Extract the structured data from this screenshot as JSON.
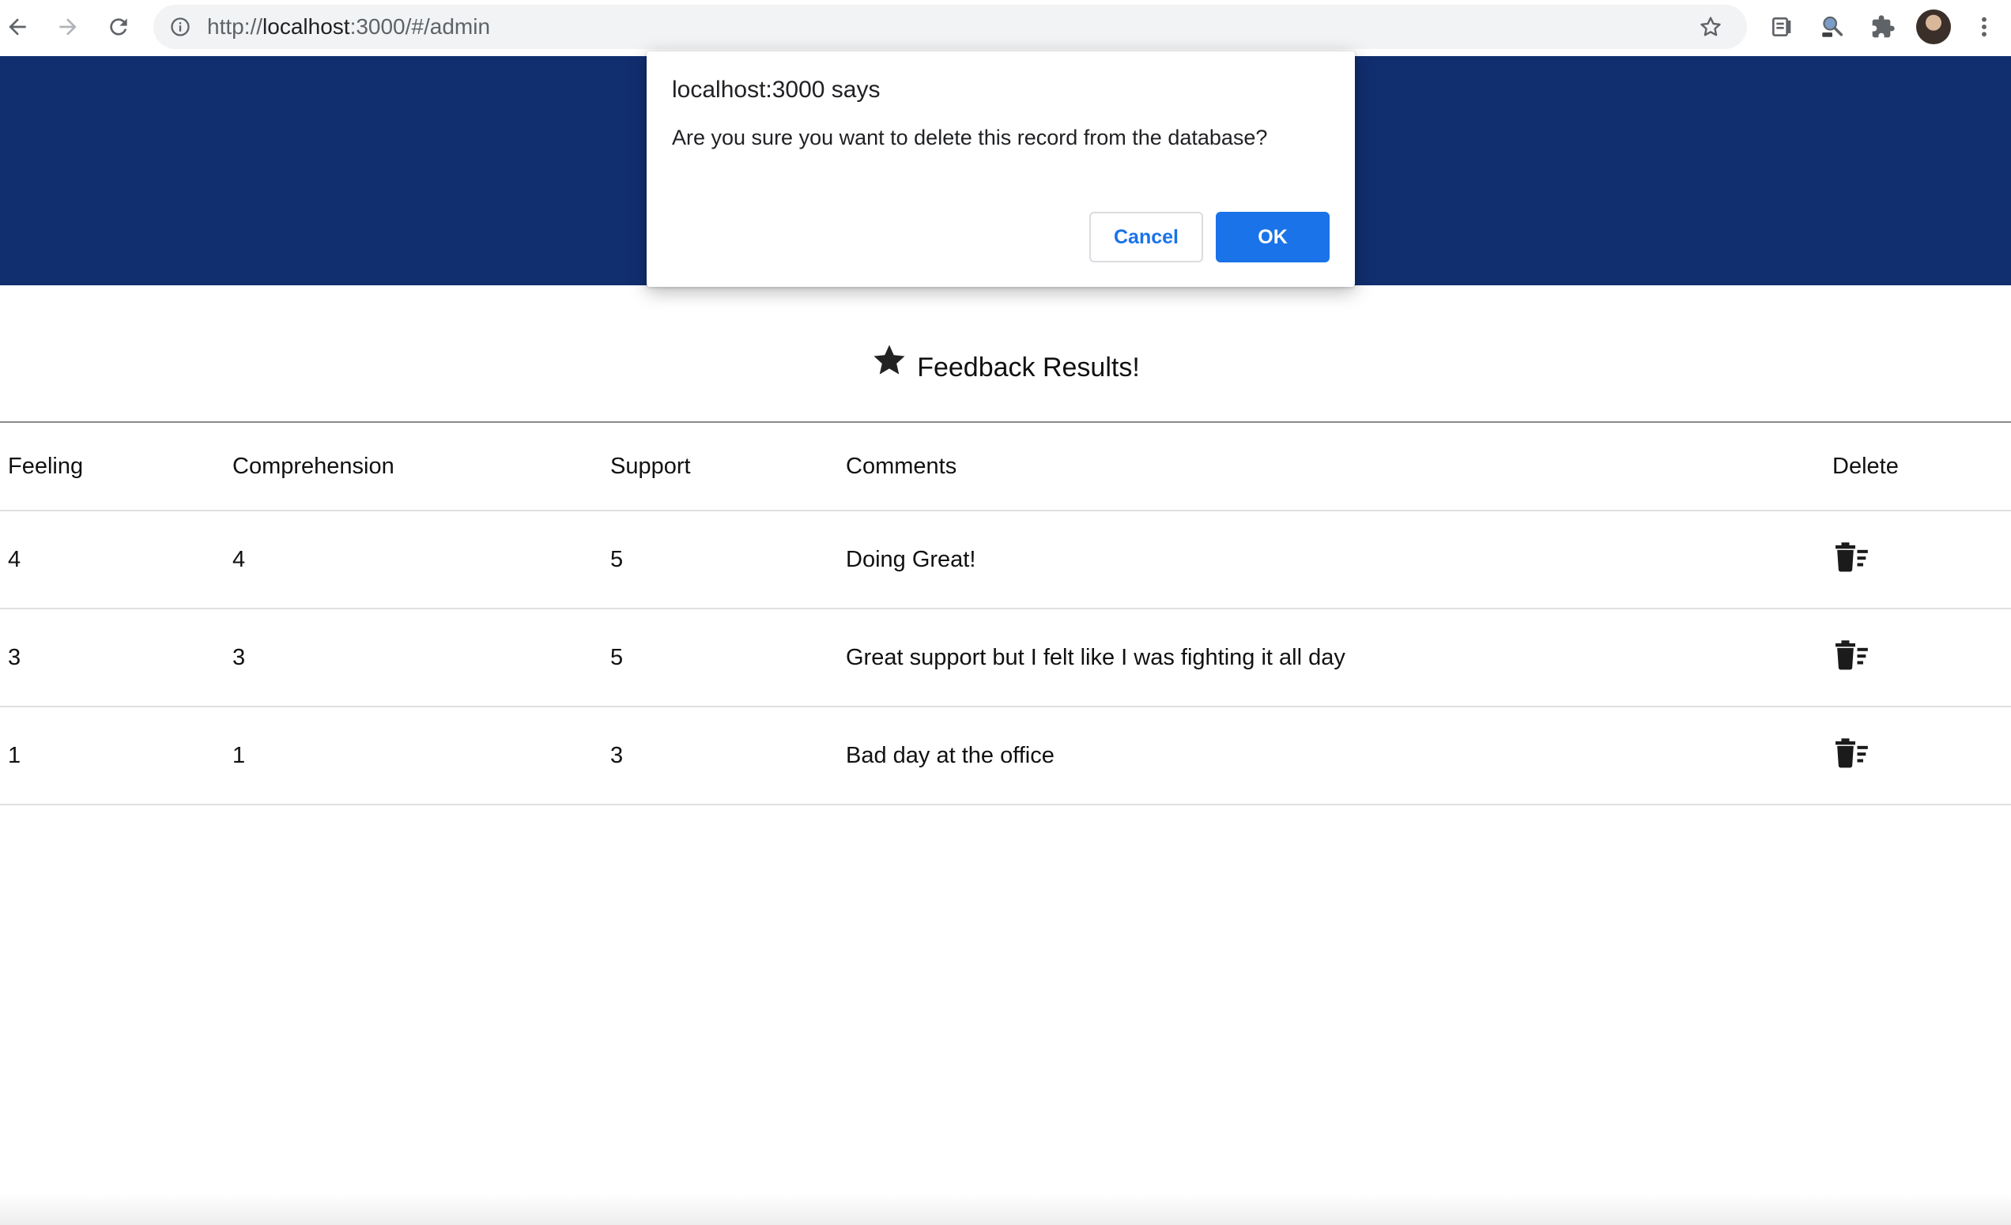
{
  "browser": {
    "url_scheme": "http://",
    "url_host": "localhost",
    "url_rest": ":3000/#/admin"
  },
  "page": {
    "title": "Feedback Results!",
    "table": {
      "headers": [
        "Feeling",
        "Comprehension",
        "Support",
        "Comments",
        "Delete"
      ],
      "rows": [
        {
          "feeling": "4",
          "comprehension": "4",
          "support": "5",
          "comments": "Doing Great!"
        },
        {
          "feeling": "3",
          "comprehension": "3",
          "support": "5",
          "comments": "Great support but I felt like I was fighting it all day"
        },
        {
          "feeling": "1",
          "comprehension": "1",
          "support": "3",
          "comments": "Bad day at the office"
        }
      ]
    }
  },
  "dialog": {
    "title": "localhost:3000 says",
    "message": "Are you sure you want to delete this record from the database?",
    "cancel_label": "Cancel",
    "ok_label": "OK"
  },
  "icons": {
    "back": "arrow-left-icon",
    "forward": "arrow-right-icon",
    "reload": "reload-icon",
    "site_info": "info-icon",
    "bookmark": "star-outline-icon",
    "reading_list": "reading-list-icon",
    "extension_a": "search-extension-icon",
    "extensions": "puzzle-icon",
    "menu": "kebab-menu-icon",
    "title_star": "star-filled-icon",
    "delete": "trash-sweep-icon"
  },
  "colors": {
    "header_band": "#112e6f",
    "primary_button": "#1a73e8",
    "omnibox": "#f1f3f4"
  }
}
